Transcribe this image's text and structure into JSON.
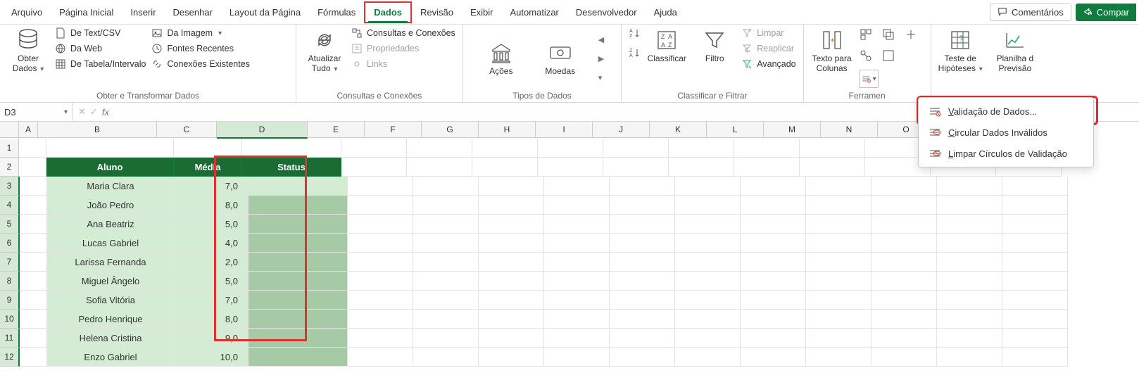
{
  "menu": {
    "items": [
      "Arquivo",
      "Página Inicial",
      "Inserir",
      "Desenhar",
      "Layout da Página",
      "Fórmulas",
      "Dados",
      "Revisão",
      "Exibir",
      "Automatizar",
      "Desenvolvedor",
      "Ajuda"
    ],
    "active_index": 6,
    "comments_label": "Comentários",
    "share_label": "Compar"
  },
  "ribbon": {
    "groups": {
      "obter": {
        "label": "Obter e Transformar Dados",
        "obter_dados": "Obter\nDados",
        "text_csv": "De Text/CSV",
        "da_web": "Da Web",
        "tabela": "De Tabela/Intervalo",
        "da_imagem": "Da Imagem",
        "fontes": "Fontes Recentes",
        "conexoes": "Conexões Existentes"
      },
      "consultas": {
        "label": "Consultas e Conexões",
        "atualizar": "Atualizar\nTudo",
        "cc": "Consultas e Conexões",
        "prop": "Propriedades",
        "links": "Links"
      },
      "tipos": {
        "label": "Tipos de Dados",
        "acoes": "Ações",
        "moedas": "Moedas"
      },
      "clasf": {
        "label": "Classificar e Filtrar",
        "classificar": "Classificar",
        "filtro": "Filtro",
        "limpar": "Limpar",
        "reaplicar": "Reaplicar",
        "avancado": "Avançado"
      },
      "ferr": {
        "label": "Ferramen",
        "texto_colunas": "Texto para\nColunas"
      },
      "analise": {
        "teste": "Teste de\nHipóteses",
        "planilha": "Planilha d\nPrevisão"
      }
    }
  },
  "dropdown": {
    "validacao": "Validação de Dados...",
    "circular": "Circular Dados Inválidos",
    "limpar": "Limpar Círculos de Validação"
  },
  "fx": {
    "name_box": "D3",
    "fx_label": "fx",
    "formula": ""
  },
  "columns": [
    "A",
    "B",
    "C",
    "D",
    "E",
    "F",
    "G",
    "H",
    "I",
    "J",
    "K",
    "L",
    "M",
    "N",
    "O"
  ],
  "rows": [
    "1",
    "2",
    "3",
    "4",
    "5",
    "6",
    "7",
    "8",
    "9",
    "10",
    "11",
    "12"
  ],
  "table": {
    "headers": {
      "aluno": "Aluno",
      "media": "Média",
      "status": "Status"
    },
    "data": [
      {
        "aluno": "Maria Clara",
        "media": "7,0"
      },
      {
        "aluno": "João Pedro",
        "media": "8,0"
      },
      {
        "aluno": "Ana Beatriz",
        "media": "5,0"
      },
      {
        "aluno": "Lucas Gabriel",
        "media": "4,0"
      },
      {
        "aluno": "Larissa Fernanda",
        "media": "2,0"
      },
      {
        "aluno": "Miguel Ângelo",
        "media": "5,0"
      },
      {
        "aluno": "Sofia Vitória",
        "media": "7,0"
      },
      {
        "aluno": "Pedro Henrique",
        "media": "8,0"
      },
      {
        "aluno": "Helena Cristina",
        "media": "9,0"
      },
      {
        "aluno": "Enzo Gabriel",
        "media": "10,0"
      }
    ]
  }
}
